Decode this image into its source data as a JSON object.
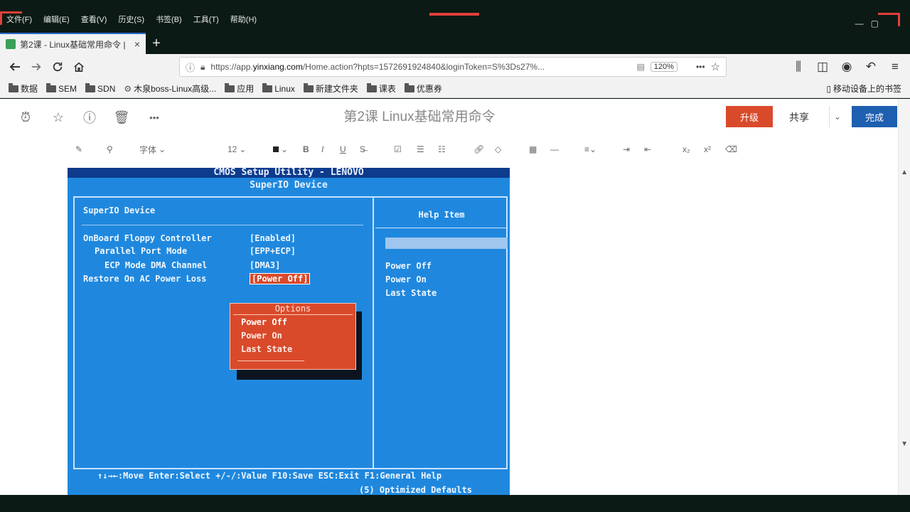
{
  "menu": [
    "文件(F)",
    "编辑(E)",
    "查看(V)",
    "历史(S)",
    "书签(B)",
    "工具(T)",
    "帮助(H)"
  ],
  "tab": {
    "title": "第2课 - Linux基础常用命令 |",
    "close": "×",
    "new": "+"
  },
  "nav": {
    "url_prefix": "https://app.",
    "url_domain": "yinxiang.com",
    "url_rest": "/Home.action?hpts=1572691924840&loginToken=S%3Ds27%...",
    "zoom": "120%",
    "more": "•••"
  },
  "bookmarks": [
    {
      "label": "数据",
      "icon": "folder-icon"
    },
    {
      "label": "SEM",
      "icon": "folder-icon"
    },
    {
      "label": "SDN",
      "icon": "folder-icon"
    },
    {
      "label": "木泉boss-Linux高级...",
      "icon": "gear-icon"
    },
    {
      "label": "应用",
      "icon": "folder-icon"
    },
    {
      "label": "Linux",
      "icon": "folder-icon"
    },
    {
      "label": "新建文件夹",
      "icon": "folder-icon"
    },
    {
      "label": "课表",
      "icon": "folder-icon"
    },
    {
      "label": "优惠券",
      "icon": "folder-icon"
    }
  ],
  "bookmarks_mobile": "移动设备上的书签",
  "note": {
    "title": "第2课   Linux基础常用命令",
    "upgrade": "升级",
    "share": "共享",
    "done": "完成",
    "font": "字体",
    "size": "12",
    "more": "•••"
  },
  "bios": {
    "title": "CMOS Setup Utility - LENOVO",
    "subtitle": "SuperIO Device",
    "section": "SuperIO Device",
    "help_title": "Help Item",
    "settings": [
      {
        "label": "OnBoard Floppy Controller",
        "value": "[Enabled]"
      },
      {
        "label": "Parallel Port Mode",
        "value": "[EPP+ECP]"
      },
      {
        "label": "ECP Mode DMA Channel",
        "value": "[DMA3]"
      },
      {
        "label": "Restore On AC Power Loss",
        "value": "[Power Off]"
      }
    ],
    "options_title": "Options",
    "options": [
      "Power Off",
      "Power On",
      "Last State"
    ],
    "help_options": [
      "Power Off",
      "Power On",
      "Last State"
    ],
    "footer": "↑↓→←:Move  Enter:Select  +/-/:Value  F10:Save  ESC:Exit  F1:General Help",
    "footer2": "(5) Optimized Defaults"
  },
  "colors": {
    "bios_blue": "#1f88de",
    "accent_orange": "#d94a2b",
    "done_blue": "#1f5fb0",
    "recording_red": "#e0403a"
  }
}
